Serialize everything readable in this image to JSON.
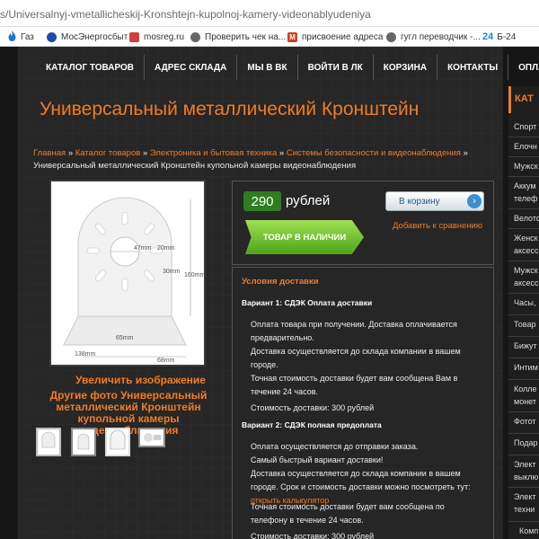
{
  "browser": {
    "url": "s/Universalnyj-vmetallicheskij-Kronshtejn-kupolnoj-kamery-videonablyudeniya",
    "bookmarks": [
      {
        "label": "Газ",
        "icon": "flame-icon",
        "color": "#1e73d0"
      },
      {
        "label": "МосЭнергосбыт",
        "icon": "energy-icon",
        "color": "#1e4aa8"
      },
      {
        "label": "mosreg.ru",
        "icon": "gift-icon",
        "color": "#d83b3b"
      },
      {
        "label": "Проверить чек на...",
        "icon": "globe-icon",
        "color": "#555555"
      },
      {
        "label": "присвоение адреса",
        "icon": "m-logo-icon",
        "color": "#d83b1a"
      },
      {
        "label": "гугл переводчик -...",
        "icon": "globe-icon",
        "color": "#555555"
      },
      {
        "label": "Б-24",
        "icon": "b24-icon",
        "color": "#1b8ad0",
        "badge": "24"
      }
    ]
  },
  "nav": {
    "items": [
      "КАТАЛОГ ТОВАРОВ",
      "АДРЕС СКЛАДА",
      "МЫ В ВК",
      "ВОЙТИ В ЛК",
      "КОРЗИНА",
      "КОНТАКТЫ",
      "ОПЛАТА"
    ]
  },
  "product": {
    "title": "Универсальный металлический Кронштейн",
    "breadcrumb": {
      "links": [
        "Главная",
        "Каталог товаров",
        "Электроника и бытовая техника",
        "Системы безопасности и видеонаблюдения"
      ],
      "separator": "»",
      "current": "Универсальный металлический Кронштейн купольной камеры видеонаблюдения"
    },
    "photo_dimensions": [
      "47mm",
      "20mm",
      "30mm",
      "160mm",
      "65mm",
      "138mm",
      "68mm"
    ],
    "enlarge_label": "Увеличить изображение",
    "other_photos_label": "Другие фото Универсальный металлический Кронштейн купольной камеры видеонаблюдения",
    "thumbnails_count": 4
  },
  "buy": {
    "price": "290",
    "currency": "рублей",
    "stock_label": "ТОВАР В НАЛИЧИИ",
    "cart_label": "В корзину",
    "compare_label": "Добавить к сравнению"
  },
  "delivery": {
    "title": "Условия доставки",
    "variant1_title": "Вариант 1: СДЭК Оплата доставки",
    "variant1_lines": [
      "Оплата товара при получении. Доставка оплачивается предварительно.",
      "Доставка осуществляется до склада компании в вашем городе.",
      "Точная стоимость доставки будет вам сообщена Вам в течение 24 часов.",
      "Стоимость доставки: 300 рублей"
    ],
    "variant2_title": "Вариант 2: СДЭК полная предоплата",
    "variant2_lines": [
      "Оплата осуществляется до отправки заказа.",
      "Самый быстрый вариант доставки!",
      "Доставка осуществляется до склада компании в вашем городе. Срок и стоимость  доставки можно посмотреть тут:",
      "Точная стоимость доставки будет вам сообщена по телефону в течение 24 часов.",
      "Стоимость доставки: 300 рублей"
    ],
    "calculator_link": "открыть калькулятор"
  },
  "sidebar": {
    "heading": "КАТ",
    "items": [
      "Спорт",
      "Елочн",
      "Мужск",
      "Аккум",
      "телеф",
      "Велото",
      "Женск",
      "аксесс",
      "Мужск",
      "аксесс",
      "Часы,",
      "Товар",
      "Бижут",
      "Интим",
      "Колле",
      "монет",
      "Фотот",
      "Подар",
      "Элект",
      "выклю",
      "Элект",
      "техни",
      "Комп"
    ]
  }
}
